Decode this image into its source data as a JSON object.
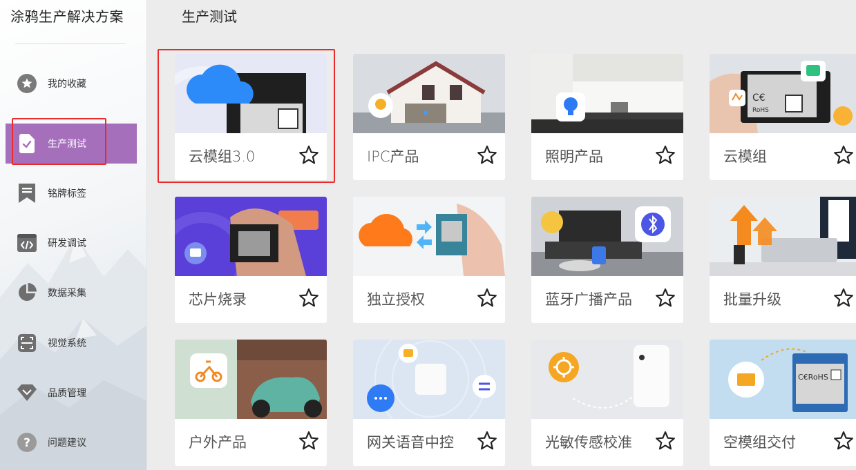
{
  "app": {
    "title": "涂鸦生产解决方案"
  },
  "sidebar": {
    "items": [
      {
        "label": "我的收藏",
        "icon": "star-circle-icon"
      },
      {
        "label": "生产测试",
        "icon": "check-document-icon",
        "active": true
      },
      {
        "label": "铭牌标签",
        "icon": "bookmark-icon"
      },
      {
        "label": "研发调试",
        "icon": "code-icon"
      },
      {
        "label": "数据采集",
        "icon": "pie-chart-icon"
      },
      {
        "label": "视觉系统",
        "icon": "scan-frame-icon"
      },
      {
        "label": "品质管理",
        "icon": "diamond-icon"
      },
      {
        "label": "问题建议",
        "icon": "question-circle-icon"
      }
    ]
  },
  "main": {
    "title": "生产测试",
    "cards": [
      {
        "label": "云模组3.0",
        "icon": "cloud-module-image"
      },
      {
        "label": "IPC产品",
        "icon": "house-camera-image"
      },
      {
        "label": "照明产品",
        "icon": "bulb-kitchen-image"
      },
      {
        "label": "云模组",
        "icon": "module-chip-image"
      },
      {
        "label": "芯片烧录",
        "icon": "chip-burn-image"
      },
      {
        "label": "独立授权",
        "icon": "cloud-authorize-image"
      },
      {
        "label": "蓝牙广播产品",
        "icon": "bluetooth-room-image"
      },
      {
        "label": "批量升级",
        "icon": "batch-upgrade-image"
      },
      {
        "label": "户外产品",
        "icon": "scooter-image"
      },
      {
        "label": "网关语音中控",
        "icon": "gateway-voice-image"
      },
      {
        "label": "光敏传感校准",
        "icon": "light-sensor-image"
      },
      {
        "label": "空模组交付",
        "icon": "empty-module-image"
      }
    ]
  },
  "colors": {
    "accent": "#a66fbc",
    "highlight": "#ec2a2a"
  }
}
